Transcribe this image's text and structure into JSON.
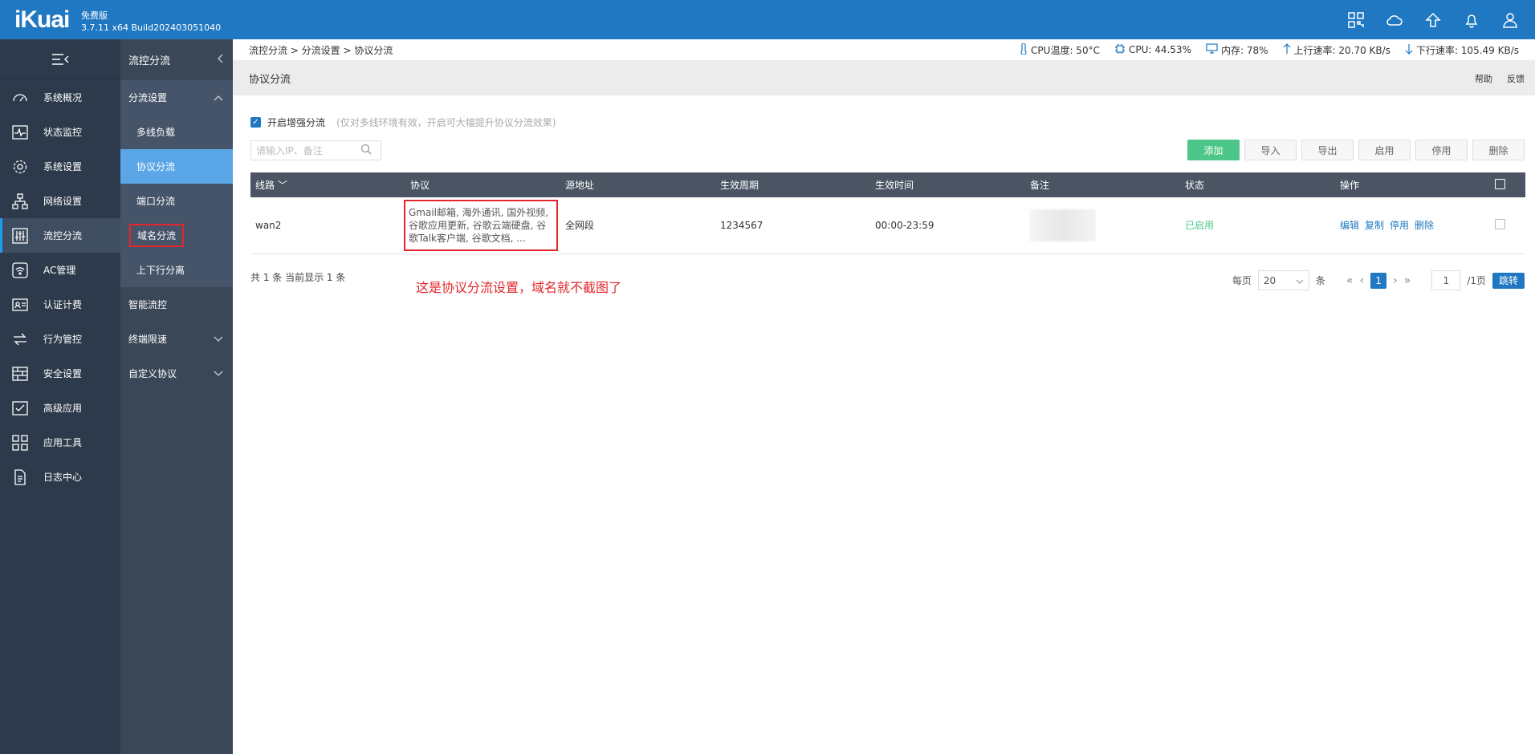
{
  "header": {
    "logo": "iKuai",
    "edition": "免费版",
    "version": "3.7.11 x64 Build202403051040",
    "icons": [
      "apps-icon",
      "cloud-icon",
      "upgrade-icon",
      "bell-icon",
      "user-icon"
    ]
  },
  "sidebar": {
    "items": [
      {
        "label": "系统概况",
        "icon": "gauge-icon"
      },
      {
        "label": "状态监控",
        "icon": "pulse-icon"
      },
      {
        "label": "系统设置",
        "icon": "gear-icon"
      },
      {
        "label": "网络设置",
        "icon": "network-icon"
      },
      {
        "label": "流控分流",
        "icon": "sliders-icon"
      },
      {
        "label": "AC管理",
        "icon": "wifi-icon"
      },
      {
        "label": "认证计费",
        "icon": "id-card-icon"
      },
      {
        "label": "行为管控",
        "icon": "arrows-icon"
      },
      {
        "label": "安全设置",
        "icon": "firewall-icon"
      },
      {
        "label": "高级应用",
        "icon": "check-box-icon"
      },
      {
        "label": "应用工具",
        "icon": "grid-icon"
      },
      {
        "label": "日志中心",
        "icon": "document-icon"
      }
    ]
  },
  "subnav": {
    "title": "流控分流",
    "group1": "分流设置",
    "items": [
      "多线负载",
      "协议分流",
      "端口分流",
      "域名分流",
      "上下行分离"
    ],
    "group2": "智能流控",
    "group3": "终端限速",
    "group4": "自定义协议"
  },
  "statusbar": {
    "breadcrumb": "流控分流 > 分流设置 > 协议分流",
    "cpu_temp": "CPU温度: 50°C",
    "cpu": "CPU: 44.53%",
    "memory": "内存: 78%",
    "upload": "上行速率: 20.70 KB/s",
    "download": "下行速率: 105.49 KB/s"
  },
  "page": {
    "title": "协议分流",
    "help": "帮助",
    "feedback": "反馈",
    "enhance_label": "开启增强分流",
    "enhance_hint": "(仅对多线环境有效，开启可大幅提升协议分流效果)",
    "search_placeholder": "请输入IP、备注",
    "buttons": {
      "add": "添加",
      "import": "导入",
      "export": "导出",
      "enable": "启用",
      "disable": "停用",
      "delete": "删除"
    }
  },
  "table": {
    "headers": [
      "线路",
      "协议",
      "源地址",
      "生效周期",
      "生效时间",
      "备注",
      "状态",
      "操作"
    ],
    "rows": [
      {
        "line": "wan2",
        "protocol": "Gmail邮箱, 海外通讯, 国外视频, 谷歌应用更新, 谷歌云端硬盘, 谷歌Talk客户端, 谷歌文档, ...",
        "source": "全网段",
        "period": "1234567",
        "time": "00:00-23:59",
        "remark": "",
        "status": "已启用",
        "ops": [
          "编辑",
          "复制",
          "停用",
          "删除"
        ]
      }
    ]
  },
  "footer": {
    "summary": "共 1 条 当前显示 1 条",
    "annotation": "这是协议分流设置，域名就不截图了",
    "per_page_label": "每页",
    "per_page": "20",
    "unit": "条",
    "current_page": "1",
    "page_input": "1",
    "total_pages": "/1页",
    "jump": "跳转"
  },
  "colors": {
    "header": "#1f78c1",
    "sidebar": "#2c3a4b",
    "accent": "#5aa6e6",
    "success": "#4cc789",
    "highlight": "#e4262b"
  }
}
